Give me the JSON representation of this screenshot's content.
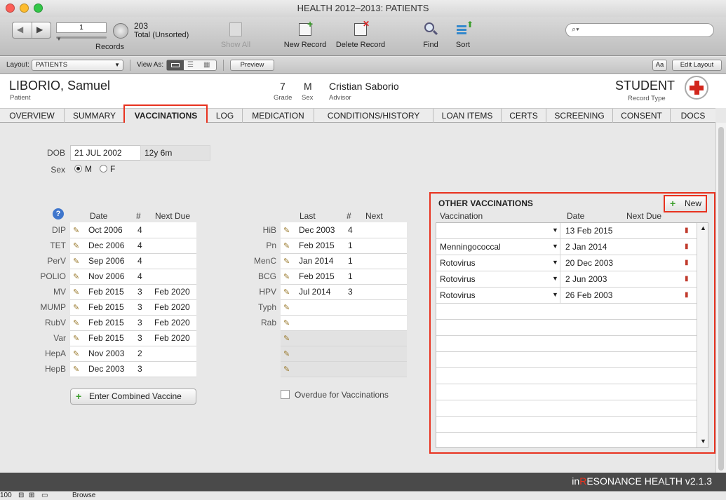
{
  "window": {
    "title": "HEALTH  2012–2013: PATIENTS"
  },
  "toolbar": {
    "record_number": "1",
    "records_label": "Records",
    "total_count": "203",
    "total_label": "Total (Unsorted)",
    "show_all": "Show All",
    "new_record": "New Record",
    "delete_record": "Delete Record",
    "find": "Find",
    "sort": "Sort"
  },
  "layoutbar": {
    "layout_label": "Layout:",
    "layout_value": "PATIENTS",
    "view_as_label": "View As:",
    "preview": "Preview",
    "aa": "Aa",
    "edit_layout": "Edit Layout"
  },
  "patient": {
    "name": "LIBORIO, Samuel",
    "name_label": "Patient",
    "grade": "7",
    "grade_label": "Grade",
    "sex": "M",
    "sex_label": "Sex",
    "advisor": "Cristian Saborio",
    "advisor_label": "Advisor",
    "record_type": "STUDENT",
    "record_type_label": "Record Type"
  },
  "tabs": [
    "OVERVIEW",
    "SUMMARY",
    "VACCINATIONS",
    "LOG",
    "MEDICATION",
    "CONDITIONS/HISTORY",
    "LOAN ITEMS",
    "CERTS",
    "SCREENING",
    "CONSENT",
    "DOCS"
  ],
  "demographics": {
    "dob_label": "DOB",
    "dob": "21 JUL 2002",
    "age": "12y 6m",
    "sex_label": "Sex",
    "sex_m": "M",
    "sex_f": "F"
  },
  "vaccines_left": {
    "headers": {
      "date": "Date",
      "num": "#",
      "next_due": "Next Due"
    },
    "rows": [
      {
        "name": "DIP",
        "date": "Oct 2006",
        "num": "4",
        "next": ""
      },
      {
        "name": "TET",
        "date": "Dec 2006",
        "num": "4",
        "next": ""
      },
      {
        "name": "PerV",
        "date": "Sep 2006",
        "num": "4",
        "next": ""
      },
      {
        "name": "POLIO",
        "date": "Nov 2006",
        "num": "4",
        "next": ""
      },
      {
        "name": "MV",
        "date": "Feb 2015",
        "num": "3",
        "next": "Feb 2020"
      },
      {
        "name": "MUMP",
        "date": "Feb 2015",
        "num": "3",
        "next": "Feb 2020"
      },
      {
        "name": "RubV",
        "date": "Feb 2015",
        "num": "3",
        "next": "Feb 2020"
      },
      {
        "name": "Var",
        "date": "Feb 2015",
        "num": "3",
        "next": "Feb 2020"
      },
      {
        "name": "HepA",
        "date": "Nov 2003",
        "num": "2",
        "next": ""
      },
      {
        "name": "HepB",
        "date": "Dec 2003",
        "num": "3",
        "next": ""
      }
    ],
    "combined_button": "Enter Combined Vaccine"
  },
  "vaccines_mid": {
    "headers": {
      "last": "Last",
      "num": "#",
      "next": "Next"
    },
    "rows": [
      {
        "name": "HiB",
        "date": "Dec 2003",
        "num": "4"
      },
      {
        "name": "Pn",
        "date": "Feb 2015",
        "num": "1"
      },
      {
        "name": "MenC",
        "date": "Jan 2014",
        "num": "1"
      },
      {
        "name": "BCG",
        "date": "Feb 2015",
        "num": "1"
      },
      {
        "name": "HPV",
        "date": "Jul 2014",
        "num": "3"
      },
      {
        "name": "Typh",
        "date": "",
        "num": ""
      },
      {
        "name": "Rab",
        "date": "",
        "num": ""
      },
      {
        "name": "",
        "date": "",
        "num": ""
      },
      {
        "name": "",
        "date": "",
        "num": ""
      },
      {
        "name": "",
        "date": "",
        "num": ""
      }
    ],
    "overdue_label": "Overdue for Vaccinations"
  },
  "other": {
    "title": "OTHER VACCINATIONS",
    "new_button": "New",
    "headers": {
      "vaccination": "Vaccination",
      "date": "Date",
      "next_due": "Next Due"
    },
    "rows": [
      {
        "vaccination": "",
        "date": "13 Feb 2015"
      },
      {
        "vaccination": "Menningococcal",
        "date": "2 Jan 2014"
      },
      {
        "vaccination": "Rotovirus",
        "date": "20 Dec 2003"
      },
      {
        "vaccination": "Rotovirus",
        "date": "2 Jun 2003"
      },
      {
        "vaccination": "Rotovirus",
        "date": "26 Feb 2003"
      }
    ]
  },
  "footer": {
    "brand_prefix": "in",
    "brand_r": "R",
    "brand_rest": "ESONANCE HEALTH v2.1.3"
  },
  "status": {
    "zoom": "100",
    "mode": "Browse"
  },
  "colors": {
    "highlight": "#e8321f",
    "footer": "#4a4a4a"
  }
}
